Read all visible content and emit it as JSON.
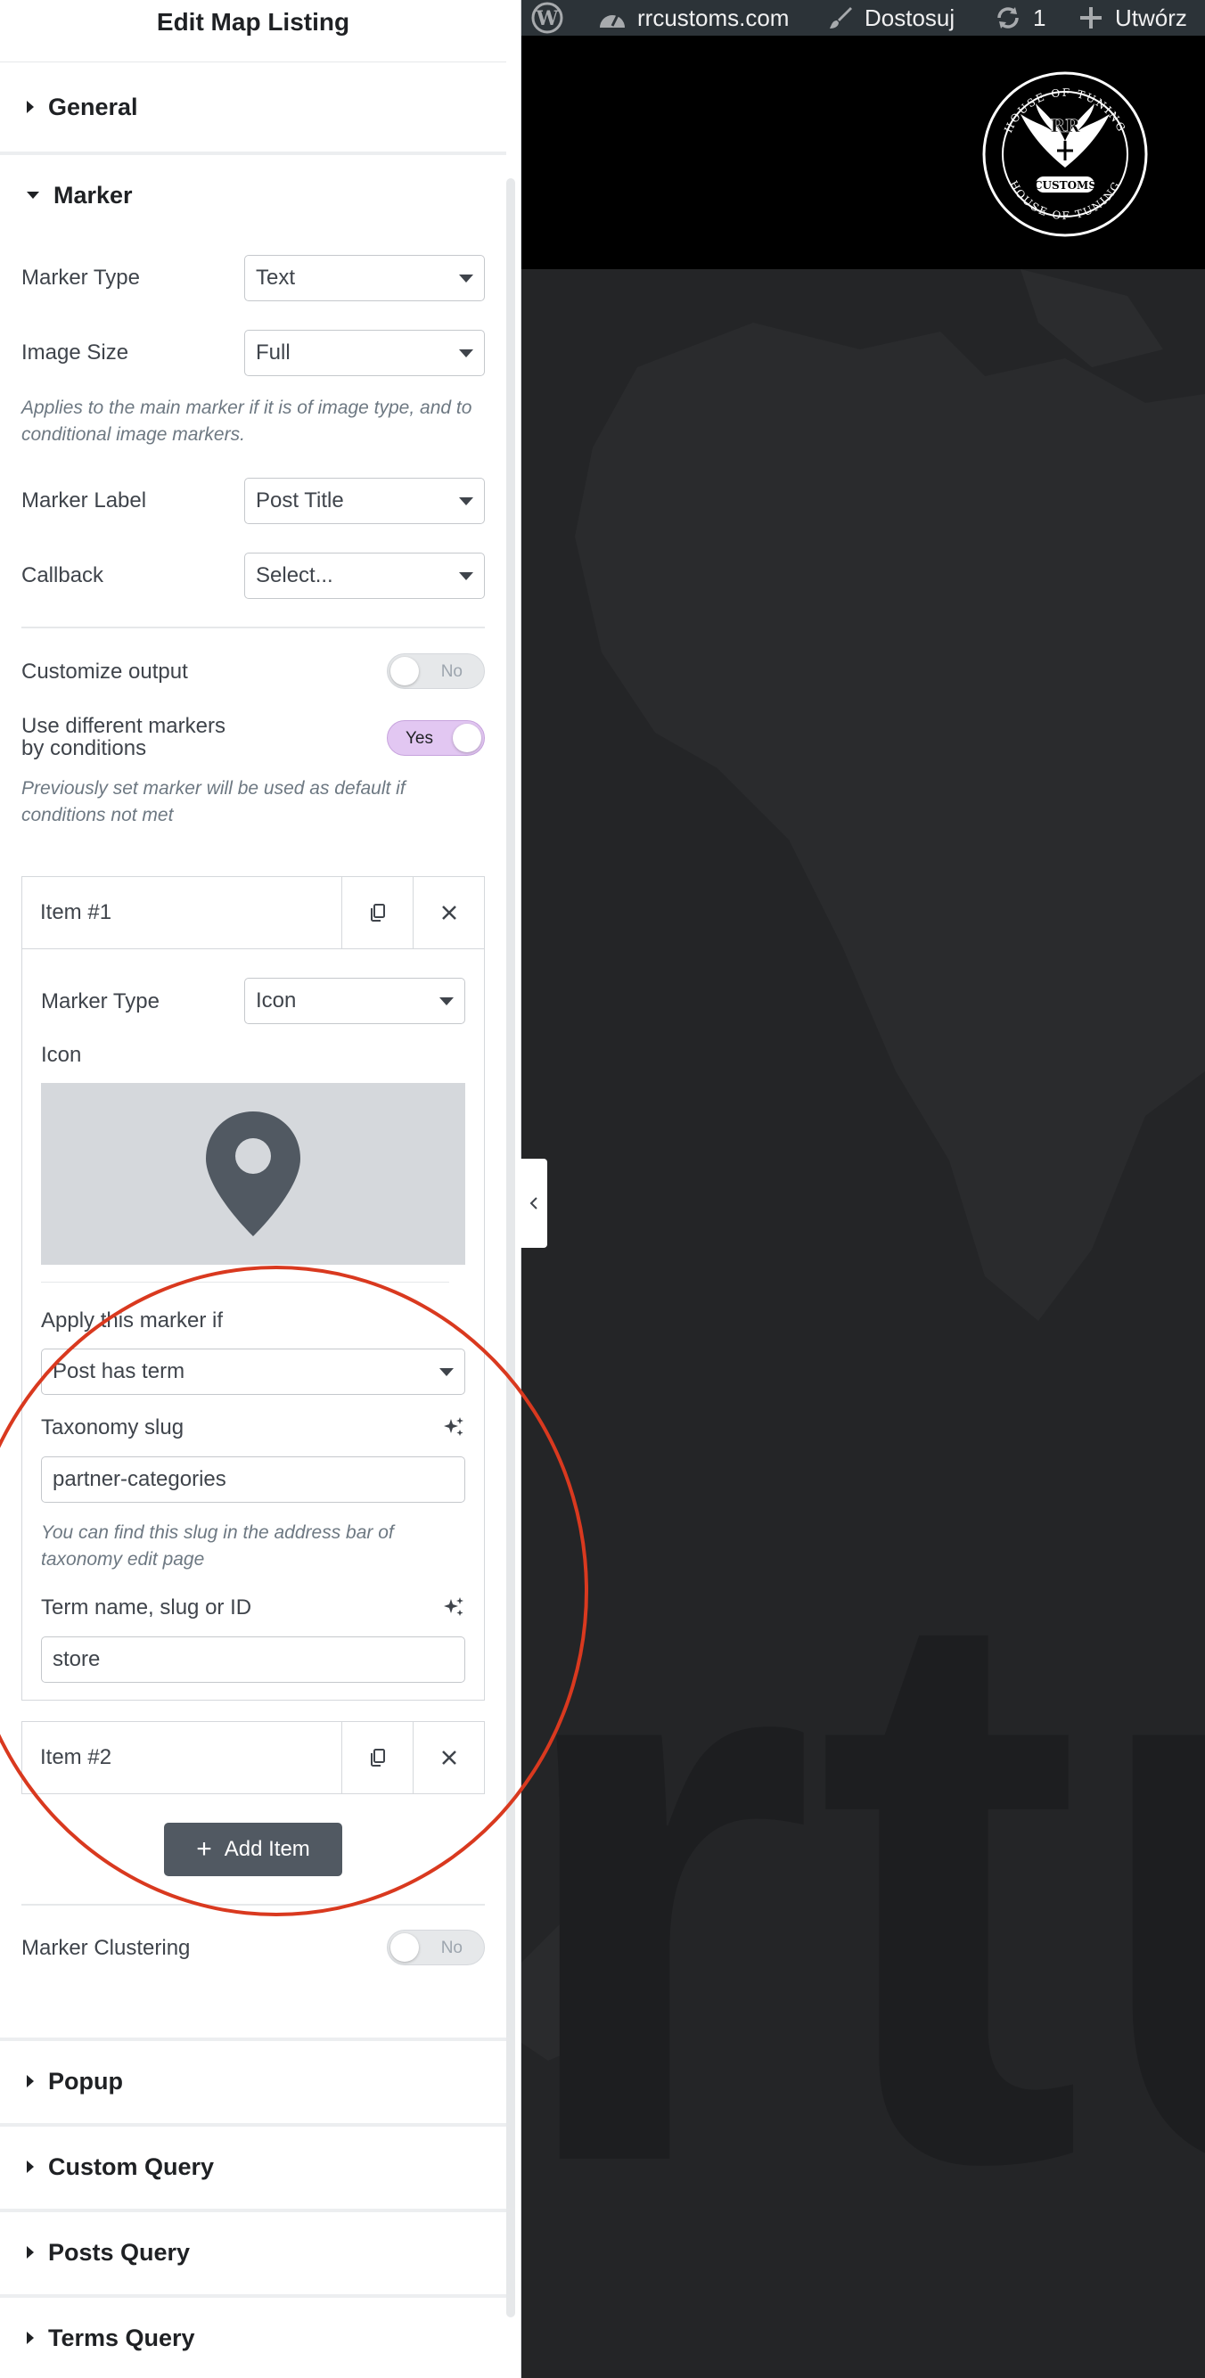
{
  "panel": {
    "title": "Edit Map Listing"
  },
  "sections": {
    "general": "General",
    "marker": "Marker",
    "popup": "Popup",
    "custom_query": "Custom Query",
    "posts_query": "Posts Query",
    "terms_query": "Terms Query"
  },
  "marker": {
    "marker_type": {
      "label": "Marker Type",
      "value": "Text"
    },
    "image_size": {
      "label": "Image Size",
      "value": "Full"
    },
    "image_size_help": "Applies to the main marker if it is of image type, and to conditional image markers.",
    "marker_label": {
      "label": "Marker Label",
      "value": "Post Title"
    },
    "callback": {
      "label": "Callback",
      "value": "Select..."
    },
    "customize_output": {
      "label": "Customize output",
      "state": "No"
    },
    "different_markers": {
      "label": "Use different markers by conditions",
      "state": "Yes"
    },
    "different_markers_help": "Previously set marker will be used as default if conditions not met",
    "items": [
      {
        "title": "Item #1"
      },
      {
        "title": "Item #2"
      }
    ],
    "item1": {
      "marker_type": {
        "label": "Marker Type",
        "value": "Icon"
      },
      "icon_label": "Icon",
      "icon_name": "map-marker-icon",
      "apply_if": {
        "label": "Apply this marker if",
        "value": "Post has term"
      },
      "taxonomy": {
        "label": "Taxonomy slug",
        "value": "partner-categories"
      },
      "taxonomy_help": "You can find this slug in the address bar of taxonomy edit page",
      "term": {
        "label": "Term name, slug or ID",
        "value": "store"
      }
    },
    "add_item": "Add Item",
    "clustering": {
      "label": "Marker Clustering",
      "state": "No"
    }
  },
  "adminbar": {
    "site": "rrcustoms.com",
    "customize": "Dostosuj",
    "updates": "1",
    "new": "Utwórz"
  },
  "logo": {
    "top_text": "HOUSE OF TUNING",
    "bottom_text": "HOUSE OF TUNING",
    "monogram": "RR",
    "word": "CUSTOMS"
  },
  "colors": {
    "accent_toggle": "#e2c7f2",
    "annotation": "#d9391f",
    "button": "#515962"
  }
}
